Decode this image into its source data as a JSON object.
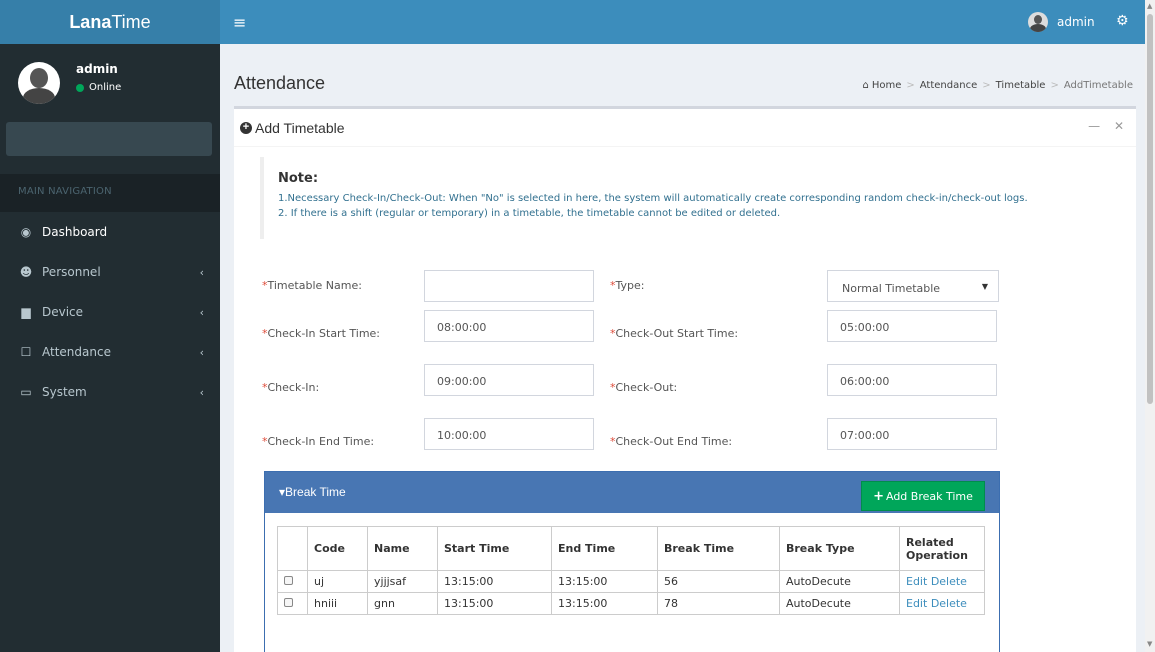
{
  "app": {
    "logo_bold": "Lana",
    "logo_rest": "Time"
  },
  "sidebar": {
    "user_name": "admin",
    "user_status": "Online",
    "nav_header": "MAIN NAVIGATION",
    "items": [
      {
        "label": "Dashboard",
        "icon": "dashboard-icon"
      },
      {
        "label": "Personnel",
        "icon": "users-icon"
      },
      {
        "label": "Device",
        "icon": "device-icon"
      },
      {
        "label": "Attendance",
        "icon": "attendance-icon"
      },
      {
        "label": "System",
        "icon": "monitor-icon"
      }
    ]
  },
  "header": {
    "user_name": "admin"
  },
  "page": {
    "title": "Attendance"
  },
  "breadcrumb": {
    "home": "Home",
    "attendance": "Attendance",
    "timetable": "Timetable",
    "current": "AddTimetable"
  },
  "box": {
    "title": "Add Timetable"
  },
  "note": {
    "title": "Note:",
    "line1": "1.Necessary Check-In/Check-Out: When \"No\" is selected in here, the system will automatically create corresponding random check-in/check-out logs.",
    "line2": "2. If there is a shift (regular or temporary) in a timetable, the timetable cannot be edited or deleted."
  },
  "form": {
    "timetable_name_label": "Timetable Name:",
    "timetable_name_value": "",
    "type_label": "Type:",
    "type_value": "Normal Timetable",
    "checkin_start_label": "Check-In Start Time:",
    "checkin_start_value": "08:00:00",
    "checkout_start_label": "Check-Out Start Time:",
    "checkout_start_value": "05:00:00",
    "checkin_label": "Check-In:",
    "checkin_value": "09:00:00",
    "checkout_label": "Check-Out:",
    "checkout_value": "06:00:00",
    "checkin_end_label": "Check-In End Time:",
    "checkin_end_value": "10:00:00",
    "checkout_end_label": "Check-Out End Time:",
    "checkout_end_value": "07:00:00"
  },
  "break_time": {
    "title": "Break Time",
    "add_button": "Add Break Time",
    "columns": {
      "code": "Code",
      "name": "Name",
      "start_time": "Start Time",
      "end_time": "End Time",
      "break_time": "Break Time",
      "break_type": "Break Type",
      "related1": "Related",
      "related2": "Operation"
    },
    "rows": [
      {
        "code": "uj",
        "name": "yjjjsaf",
        "start_time": "13:15:00",
        "end_time": "13:15:00",
        "break_time": "56",
        "break_type": "AutoDecute",
        "edit": "Edit",
        "delete": "Delete"
      },
      {
        "code": "hniii",
        "name": "gnn",
        "start_time": "13:15:00",
        "end_time": "13:15:00",
        "break_time": "78",
        "break_type": "AutoDecute",
        "edit": "Edit",
        "delete": "Delete"
      }
    ]
  },
  "colors": {
    "header": "#3c8dbc",
    "logo": "#367fa9",
    "sidebar": "#222d32",
    "panel": "#4876b3",
    "add_button": "#00a65a",
    "required": "#dd4b39"
  }
}
